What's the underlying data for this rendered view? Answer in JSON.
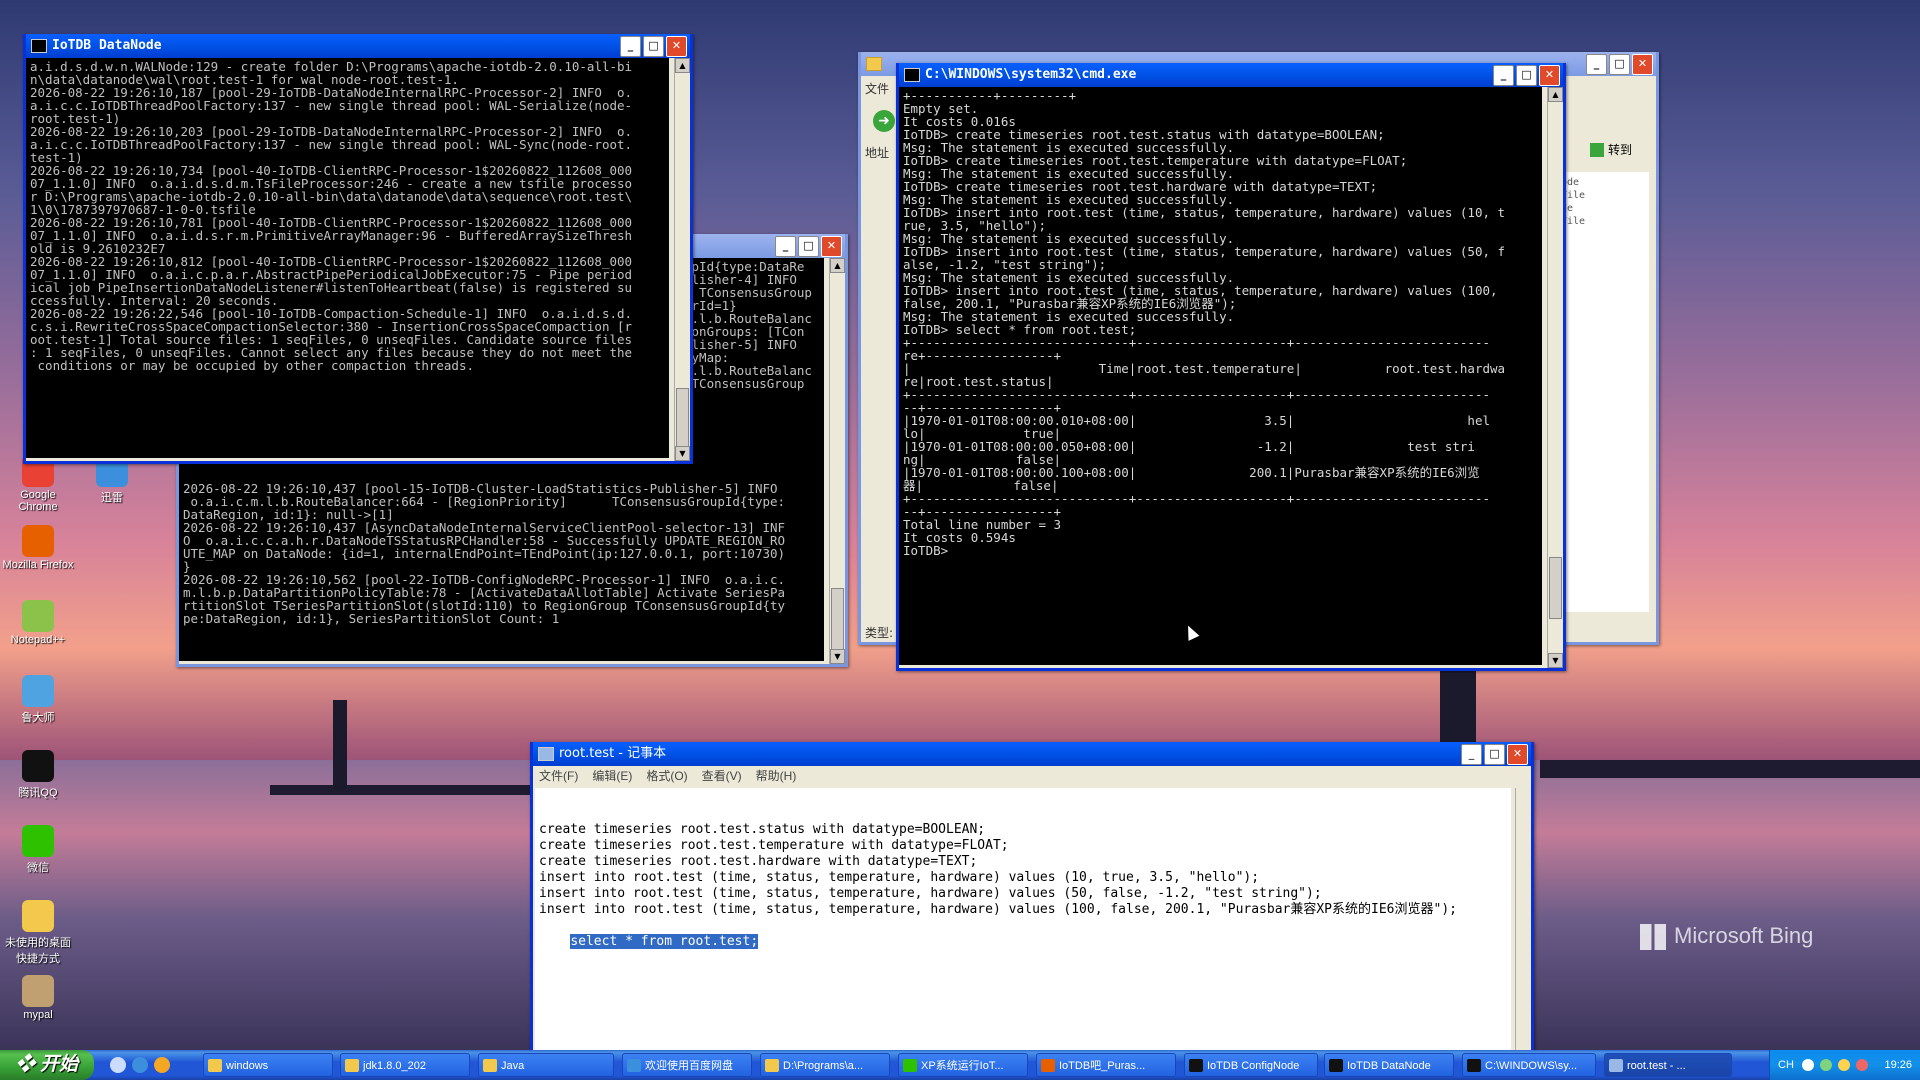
{
  "desktop": {
    "icons": [
      {
        "label": "Google Chrome",
        "color": "#e94235"
      },
      {
        "label": "迅雷",
        "color": "#3b8fdc"
      },
      {
        "label": "Mozilla Firefox",
        "color": "#e66000"
      },
      {
        "label": "Notepad++",
        "color": "#8bc34a"
      },
      {
        "label": "鲁大师",
        "color": "#4fa3e0"
      },
      {
        "label": "腾讯QQ",
        "color": "#111111"
      },
      {
        "label": "微信",
        "color": "#2dc100"
      },
      {
        "label": "未使用的桌面快捷方式",
        "color": "#f2c94c"
      },
      {
        "label": "mypal",
        "color": "#c0a070"
      }
    ],
    "watermark": "Microsoft Bing"
  },
  "datanode_window": {
    "title": "IoTDB DataNode",
    "lines": [
      "a.i.d.s.d.w.n.WALNode:129 - create folder D:\\Programs\\apache-iotdb-2.0.10-all-bi",
      "n\\data\\datanode\\wal\\root.test-1 for wal node-root.test-1.",
      "2026-08-22 19:26:10,187 [pool-29-IoTDB-DataNodeInternalRPC-Processor-2] INFO  o.",
      "a.i.c.c.IoTDBThreadPoolFactory:137 - new single thread pool: WAL-Serialize(node-",
      "root.test-1)",
      "2026-08-22 19:26:10,203 [pool-29-IoTDB-DataNodeInternalRPC-Processor-2] INFO  o.",
      "a.i.c.c.IoTDBThreadPoolFactory:137 - new single thread pool: WAL-Sync(node-root.",
      "test-1)",
      "2026-08-22 19:26:10,734 [pool-40-IoTDB-ClientRPC-Processor-1$20260822_112608_000",
      "07_1.1.0] INFO  o.a.i.d.s.d.m.TsFileProcessor:246 - create a new tsfile processo",
      "r D:\\Programs\\apache-iotdb-2.0.10-all-bin\\data\\datanode\\data\\sequence\\root.test\\",
      "1\\0\\1787397970687-1-0-0.tsfile",
      "2026-08-22 19:26:10,781 [pool-40-IoTDB-ClientRPC-Processor-1$20260822_112608_000",
      "07_1.1.0] INFO  o.a.i.d.s.r.m.PrimitiveArrayManager:96 - BufferedArraySizeThresh",
      "old is 9.2610232E7",
      "2026-08-22 19:26:10,812 [pool-40-IoTDB-ClientRPC-Processor-1$20260822_112608_000",
      "07_1.1.0] INFO  o.a.i.c.p.a.r.AbstractPipePeriodicalJobExecutor:75 - Pipe period",
      "ical job PipeInsertionDataNodeListener#listenToHeartbeat(false) is registered su",
      "ccessfully. Interval: 20 seconds.",
      "2026-08-22 19:26:22,546 [pool-10-IoTDB-Compaction-Schedule-1] INFO  o.a.i.d.s.d.",
      "c.s.i.RewriteCrossSpaceCompactionSelector:380 - InsertionCrossSpaceCompaction [r",
      "oot.test-1] Total source files: 1 seqFiles, 0 unseqFiles. Candidate source files",
      ": 1 seqFiles, 0 unseqFiles. Cannot select any files because they do not meet the",
      " conditions or may be occupied by other compaction threads."
    ]
  },
  "confignode_window": {
    "title": "",
    "right_fragments": [
      "upId{type:DataRe",
      "",
      "",
      "",
      "blisher-4] INFO",
      "  TConsensusGroup",
      "erId=1}",
      "a.l.b.RouteBalanc",
      "ionGroups: [TCon",
      "",
      "blisher-5] INFO",
      "tyMap:",
      "a.l.b.RouteBalanc",
      "[TConsensusGroup"
    ],
    "lines": [
      "2026-08-22 19:26:10,437 [pool-15-IoTDB-Cluster-LoadStatistics-Publisher-5] INFO",
      " o.a.i.c.m.l.b.RouteBalancer:664 - [RegionPriority]      TConsensusGroupId{type:",
      "DataRegion, id:1}: null->[1]",
      "2026-08-22 19:26:10,437 [AsyncDataNodeInternalServiceClientPool-selector-13] INF",
      "O  o.a.i.c.c.a.h.r.DataNodeTSStatusRPCHandler:58 - Successfully UPDATE_REGION_RO",
      "UTE_MAP on DataNode: {id=1, internalEndPoint=TEndPoint(ip:127.0.0.1, port:10730)",
      "}",
      "2026-08-22 19:26:10,562 [pool-22-IoTDB-ConfigNodeRPC-Processor-1] INFO  o.a.i.c.",
      "m.l.b.p.DataPartitionPolicyTable:78 - [ActivateDataAllotTable] Activate SeriesPa",
      "rtitionSlot TSeriesPartitionSlot(slotId:110) to RegionGroup TConsensusGroupId{ty",
      "pe:DataRegion, id:1}, SeriesPartitionSlot Count: 1"
    ]
  },
  "cmd_window": {
    "title": "C:\\WINDOWS\\system32\\cmd.exe",
    "lines": [
      "+-----------+---------+",
      "Empty set.",
      "It costs 0.016s",
      "IoTDB> create timeseries root.test.status with datatype=BOOLEAN;",
      "Msg: The statement is executed successfully.",
      "IoTDB> create timeseries root.test.temperature with datatype=FLOAT;",
      "Msg: The statement is executed successfully.",
      "IoTDB> create timeseries root.test.hardware with datatype=TEXT;",
      "Msg: The statement is executed successfully.",
      "IoTDB> insert into root.test (time, status, temperature, hardware) values (10, t",
      "rue, 3.5, \"hello\");",
      "Msg: The statement is executed successfully.",
      "IoTDB> insert into root.test (time, status, temperature, hardware) values (50, f",
      "alse, -1.2, \"test string\");",
      "Msg: The statement is executed successfully.",
      "IoTDB> insert into root.test (time, status, temperature, hardware) values (100,",
      "false, 200.1, \"Purasbar兼容XP系统的IE6浏览器\");",
      "Msg: The statement is executed successfully.",
      "IoTDB> select * from root.test;",
      "+-----------------------------+--------------------+--------------------------",
      "re+-----------------+",
      "|                         Time|root.test.temperature|           root.test.hardwa",
      "re|root.test.status|",
      "+-----------------------------+--------------------+--------------------------",
      "--+-----------------+",
      "|1970-01-01T08:00:00.010+08:00|                 3.5|                       hel",
      "lo|             true|",
      "|1970-01-01T08:00:00.050+08:00|                -1.2|               test stri",
      "ng|            false|",
      "|1970-01-01T08:00:00.100+08:00|               200.1|Purasbar兼容XP系统的IE6浏览",
      "器|            false|",
      "+-----------------------------+--------------------+--------------------------",
      "--+-----------------+",
      "Total line number = 3",
      "It costs 0.594s",
      "IoTDB>"
    ]
  },
  "explorer_window": {
    "menu_label": "文件",
    "address_label": "地址",
    "go_label": "转到",
    "type_label": "类型:",
    "side_items": [
      "ode",
      "File",
      "",
      "de",
      "File"
    ]
  },
  "notepad_window": {
    "title": "root.test - 记事本",
    "menu": [
      "文件(F)",
      "编辑(E)",
      "格式(O)",
      "查看(V)",
      "帮助(H)"
    ],
    "lines": [
      "create timeseries root.test.status with datatype=BOOLEAN;",
      "create timeseries root.test.temperature with datatype=FLOAT;",
      "create timeseries root.test.hardware with datatype=TEXT;",
      "insert into root.test (time, status, temperature, hardware) values (10, true, 3.5, \"hello\");",
      "insert into root.test (time, status, temperature, hardware) values (50, false, -1.2, \"test string\");",
      "insert into root.test (time, status, temperature, hardware) values (100, false, 200.1, \"Purasbar兼容XP系统的IE6浏览器\");"
    ],
    "selected_line": "select * from root.test;"
  },
  "taskbar": {
    "start_label": "开始",
    "buttons": [
      {
        "label": "windows",
        "color": "#f2c94c"
      },
      {
        "label": "jdk1.8.0_202",
        "color": "#f2c94c"
      },
      {
        "label": "Java",
        "color": "#f2c94c"
      },
      {
        "label": "欢迎使用百度网盘",
        "color": "#3b8fdc"
      },
      {
        "label": "D:\\Programs\\a...",
        "color": "#f2c94c"
      },
      {
        "label": "XP系统运行IoT...",
        "color": "#2dc100"
      },
      {
        "label": "IoTDB吧_Puras...",
        "color": "#e66000"
      },
      {
        "label": "IoTDB ConfigNode",
        "color": "#111111"
      },
      {
        "label": "IoTDB DataNode",
        "color": "#111111"
      },
      {
        "label": "C:\\WINDOWS\\sy...",
        "color": "#111111"
      },
      {
        "label": "root.test - ...",
        "color": "#9ab8e6"
      }
    ],
    "lang": "CH",
    "clock": "19:26"
  }
}
